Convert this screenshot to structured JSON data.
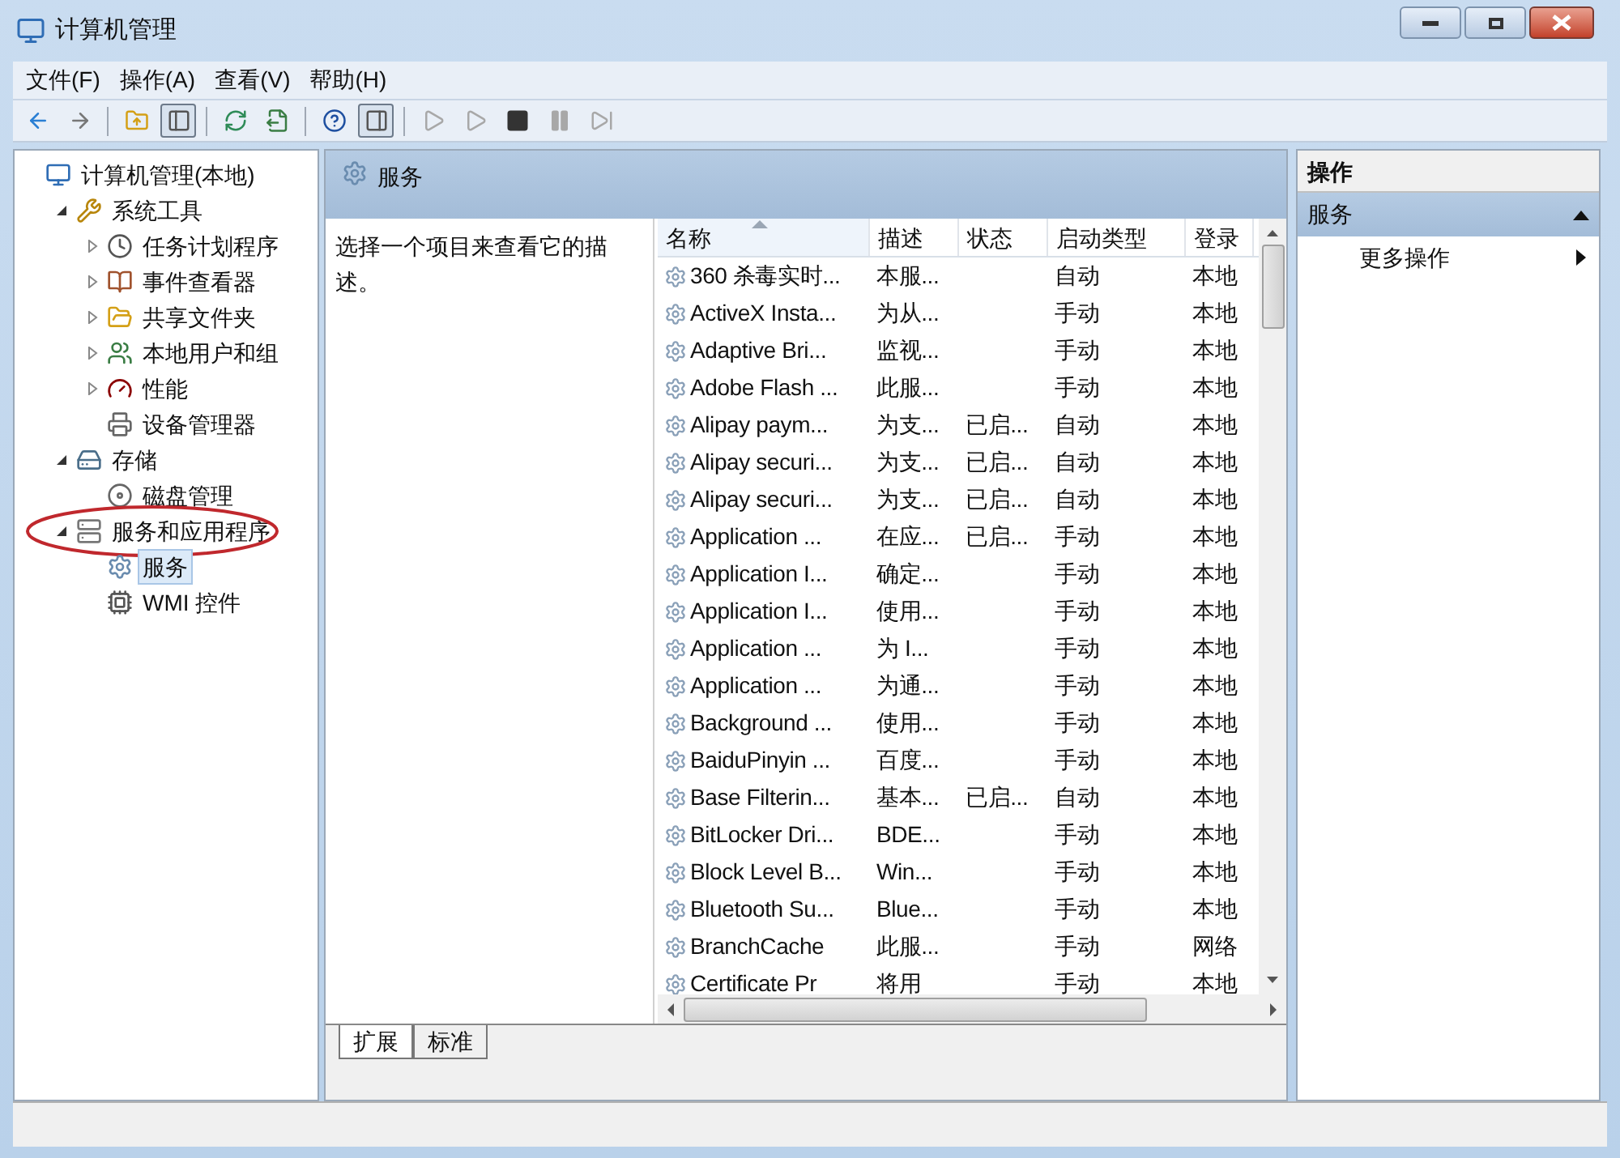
{
  "window": {
    "title": "计算机管理"
  },
  "menu": [
    "文件(F)",
    "操作(A)",
    "查看(V)",
    "帮助(H)"
  ],
  "toolbar": [
    {
      "kind": "back",
      "disabled": false
    },
    {
      "kind": "forward",
      "disabled": false
    },
    {
      "kind": "sep"
    },
    {
      "kind": "up",
      "disabled": false
    },
    {
      "kind": "tree",
      "pressed": true
    },
    {
      "kind": "sep"
    },
    {
      "kind": "refresh",
      "disabled": false
    },
    {
      "kind": "export",
      "disabled": false
    },
    {
      "kind": "sep"
    },
    {
      "kind": "help",
      "disabled": false
    },
    {
      "kind": "actionpane",
      "pressed": true
    },
    {
      "kind": "sep"
    },
    {
      "kind": "play",
      "disabled": true
    },
    {
      "kind": "play",
      "disabled": true
    },
    {
      "kind": "stop",
      "disabled": false
    },
    {
      "kind": "pause",
      "disabled": true
    },
    {
      "kind": "resume",
      "disabled": true
    }
  ],
  "tree": [
    {
      "label": "计算机管理(本地)",
      "kind": "computer",
      "selected": false,
      "children": [
        {
          "label": "系统工具",
          "kind": "tools",
          "expanded": true,
          "selected": false,
          "children": [
            {
              "label": "任务计划程序",
              "kind": "clock",
              "expanded": false,
              "selected": false
            },
            {
              "label": "事件查看器",
              "kind": "book",
              "expanded": false,
              "selected": false
            },
            {
              "label": "共享文件夹",
              "kind": "folder",
              "expanded": false,
              "selected": false
            },
            {
              "label": "本地用户和组",
              "kind": "users",
              "expanded": false,
              "selected": false
            },
            {
              "label": "性能",
              "kind": "gauge",
              "expanded": false,
              "selected": false
            },
            {
              "label": "设备管理器",
              "kind": "device",
              "selected": false
            }
          ]
        },
        {
          "label": "存储",
          "kind": "storage",
          "expanded": true,
          "selected": false,
          "children": [
            {
              "label": "磁盘管理",
              "kind": "disk",
              "selected": false
            }
          ]
        },
        {
          "label": "服务和应用程序",
          "kind": "server",
          "expanded": true,
          "selected": false,
          "highlighted": true,
          "children": [
            {
              "label": "服务",
              "kind": "gear",
              "selected": true
            },
            {
              "label": "WMI 控件",
              "kind": "wmi",
              "selected": false
            }
          ]
        }
      ]
    }
  ],
  "center": {
    "title": "服务",
    "description": "选择一个项目来查看它的描述。",
    "table": {
      "columns": [
        {
          "label": "名称",
          "sorted": true
        },
        {
          "label": "描述",
          "sorted": false
        },
        {
          "label": "状态",
          "sorted": false
        },
        {
          "label": "启动类型",
          "sorted": false
        },
        {
          "label": "登录",
          "sorted": false
        }
      ],
      "rows": [
        [
          "360 杀毒实时...",
          "本服...",
          "",
          "自动",
          "本地"
        ],
        [
          "ActiveX Insta...",
          "为从...",
          "",
          "手动",
          "本地"
        ],
        [
          "Adaptive Bri...",
          "监视...",
          "",
          "手动",
          "本地"
        ],
        [
          "Adobe Flash ...",
          "此服...",
          "",
          "手动",
          "本地"
        ],
        [
          "Alipay paym...",
          "为支...",
          "已启...",
          "自动",
          "本地"
        ],
        [
          "Alipay securi...",
          "为支...",
          "已启...",
          "自动",
          "本地"
        ],
        [
          "Alipay securi...",
          "为支...",
          "已启...",
          "自动",
          "本地"
        ],
        [
          "Application ...",
          "在应...",
          "已启...",
          "手动",
          "本地"
        ],
        [
          "Application I...",
          "确定...",
          "",
          "手动",
          "本地"
        ],
        [
          "Application I...",
          "使用...",
          "",
          "手动",
          "本地"
        ],
        [
          "Application ...",
          "为 I...",
          "",
          "手动",
          "本地"
        ],
        [
          "Application ...",
          "为通...",
          "",
          "手动",
          "本地"
        ],
        [
          "Background ...",
          "使用...",
          "",
          "手动",
          "本地"
        ],
        [
          "BaiduPinyin ...",
          "百度...",
          "",
          "手动",
          "本地"
        ],
        [
          "Base Filterin...",
          "基本...",
          "已启...",
          "自动",
          "本地"
        ],
        [
          "BitLocker Dri...",
          "BDE...",
          "",
          "手动",
          "本地"
        ],
        [
          "Block Level B...",
          "Win...",
          "",
          "手动",
          "本地"
        ],
        [
          "Bluetooth Su...",
          "Blue...",
          "",
          "手动",
          "本地"
        ],
        [
          "BranchCache",
          "此服...",
          "",
          "手动",
          "网络"
        ],
        [
          "Certificate Pr",
          "将用",
          "",
          "手动",
          "本地"
        ]
      ]
    },
    "tabs": [
      {
        "label": "扩展",
        "selected": true
      },
      {
        "label": "标准",
        "selected": false
      }
    ]
  },
  "actions": {
    "title": "操作",
    "sections": [
      {
        "label": "服务",
        "expanded": true,
        "items": [
          {
            "label": "更多操作",
            "submenu": true
          }
        ]
      }
    ]
  }
}
